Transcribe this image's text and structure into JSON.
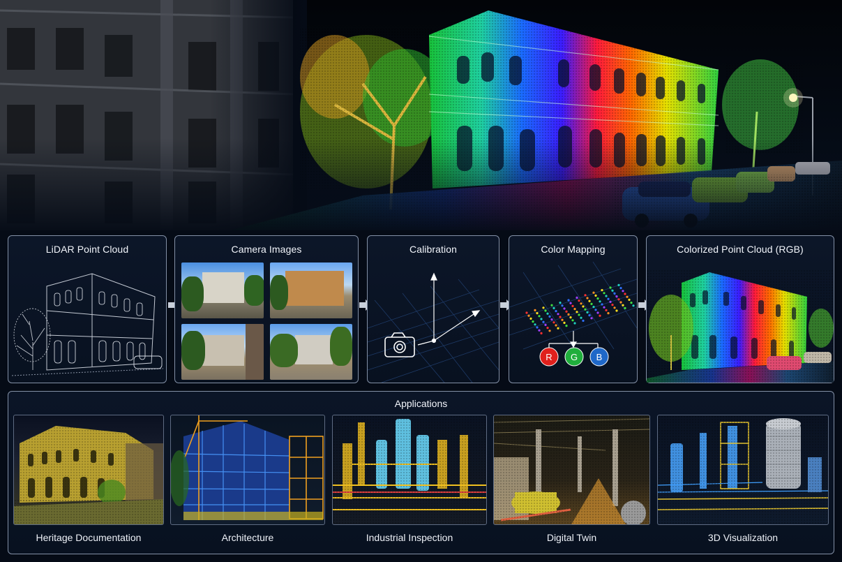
{
  "pipeline": {
    "lidar_title": "LiDAR Point Cloud",
    "camera_title": "Camera Images",
    "calibration_title": "Calibration",
    "color_mapping_title": "Color Mapping",
    "colorized_title": "Colorized Point Cloud (RGB)",
    "channels": [
      "R",
      "G",
      "B"
    ]
  },
  "applications": {
    "title": "Applications",
    "items": [
      "Heritage Documentation",
      "Architecture",
      "Industrial Inspection",
      "Digital Twin",
      "3D Visualization"
    ]
  },
  "colors": {
    "red": "#e0201c",
    "green": "#1fae3c",
    "blue": "#1f68c8",
    "border": "#8390a6",
    "panel_bg": "#0c1628"
  }
}
